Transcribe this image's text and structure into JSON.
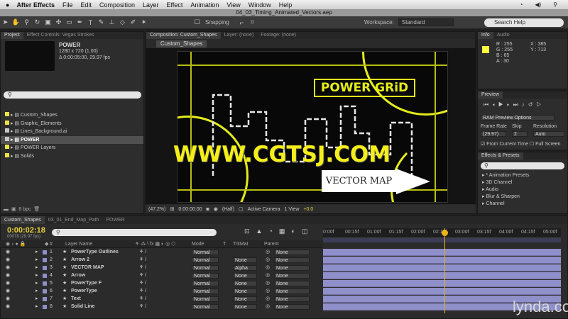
{
  "menubar": {
    "app": "After Effects",
    "items": [
      "File",
      "Edit",
      "Composition",
      "Layer",
      "Effect",
      "Animation",
      "View",
      "Window",
      "Help"
    ]
  },
  "title": "04_03_Timing_Animated_Vectors.aep",
  "toolbar": {
    "snapping": "Snapping",
    "workspace_label": "Workspace:",
    "workspace_value": "Standard",
    "search": "Search Help"
  },
  "project": {
    "tab1": "Project",
    "tab2": "Effect Controls: Vegas Strokes",
    "comp_name": "POWER",
    "comp_size": "1280 x 720 (1.00)",
    "comp_dur": "Δ 0:00:05:00, 29.97 fps",
    "items": [
      {
        "name": "Custom_Shapes",
        "color": "#ebe14a"
      },
      {
        "name": "Graphic_Elements",
        "color": "#ebe14a"
      },
      {
        "name": "Lines_Background.ai",
        "color": "#c8c8c8"
      },
      {
        "name": "POWER",
        "color": "#c8c8c8"
      },
      {
        "name": "POWER Layers",
        "color": "#ebe14a"
      },
      {
        "name": "Solids",
        "color": "#ebe14a"
      }
    ],
    "bpc": "8 bpc"
  },
  "comp": {
    "tab1": "Composition: Custom_Shapes",
    "tab2": "Layer: (none)",
    "tab3": "Footage: (none)",
    "subtab": "Custom_Shapes",
    "bottom": {
      "zoom": "(47.2%)",
      "timecode": "0:00:00:00",
      "res": "(Half)",
      "camera": "Active Camera",
      "views": "1 View",
      "offset": "+0.0"
    }
  },
  "artwork": {
    "power_grid": "POWER GRiD",
    "vector_map": "VECTOR MAP"
  },
  "watermark": "WWW.CGTSJ.COM",
  "info": {
    "tab1": "Info",
    "tab2": "Audio",
    "r": "R : 255",
    "g": "G : 255",
    "b": "B : 65",
    "a": "A : 30",
    "x": "X : 385",
    "y": "Y : 713"
  },
  "preview": {
    "tab": "Preview",
    "ram": "RAM Preview Options",
    "frame_rate_label": "Frame Rate",
    "skip_label": "Skip",
    "res_label": "Resolution",
    "frame_rate": "(29.97)",
    "skip": "2",
    "res": "Auto",
    "from_current": "From Current Time",
    "full_screen": "Full Screen"
  },
  "effects": {
    "tab": "Effects & Presets",
    "items": [
      "* Animation Presets",
      "3D Channel",
      "Audio",
      "Blur & Sharpen",
      "Channel"
    ]
  },
  "timeline": {
    "tabs": [
      "Custom_Shapes",
      "03_01_End_Map_Path",
      "POWER"
    ],
    "timecode": "0:00:02:18",
    "frames": "00078 (29.97 fps)",
    "headers": {
      "name": "Layer Name",
      "mode": "Mode",
      "t": "T",
      "trkmat": "TrkMat",
      "parent": "Parent"
    },
    "ruler": [
      "0:00f",
      "00:15f",
      "01:00f",
      "01:15f",
      "02:00f",
      "02:15f",
      "03:00f",
      "03:15f",
      "04:00f",
      "04:15f",
      "05:00f"
    ],
    "layers": [
      {
        "num": "1",
        "name": "PowerType Outlines",
        "color": "#8f8fc9",
        "mode": "Normal",
        "trkmat": "",
        "parent": "None"
      },
      {
        "num": "2",
        "name": "Arrow 2",
        "color": "#8f8fc9",
        "mode": "Normal",
        "trkmat": "None",
        "parent": "None"
      },
      {
        "num": "3",
        "name": "VECTOR MAP",
        "color": "#8f8fc9",
        "mode": "Normal",
        "trkmat": "Alpha",
        "parent": "None"
      },
      {
        "num": "4",
        "name": "Arrow",
        "color": "#8f8fc9",
        "mode": "Normal",
        "trkmat": "None",
        "parent": "None"
      },
      {
        "num": "5",
        "name": "PowerType F",
        "color": "#8f8fc9",
        "mode": "Normal",
        "trkmat": "None",
        "parent": "None"
      },
      {
        "num": "6",
        "name": "PowerType",
        "color": "#8f8fc9",
        "mode": "Normal",
        "trkmat": "None",
        "parent": "None"
      },
      {
        "num": "7",
        "name": "Text",
        "color": "#8f8fc9",
        "mode": "Normal",
        "trkmat": "None",
        "parent": "None"
      },
      {
        "num": "8",
        "name": "Solid Line",
        "color": "#8f8fc9",
        "mode": "Normal",
        "trkmat": "None",
        "parent": "None"
      }
    ]
  },
  "lynda": "lynda.com"
}
